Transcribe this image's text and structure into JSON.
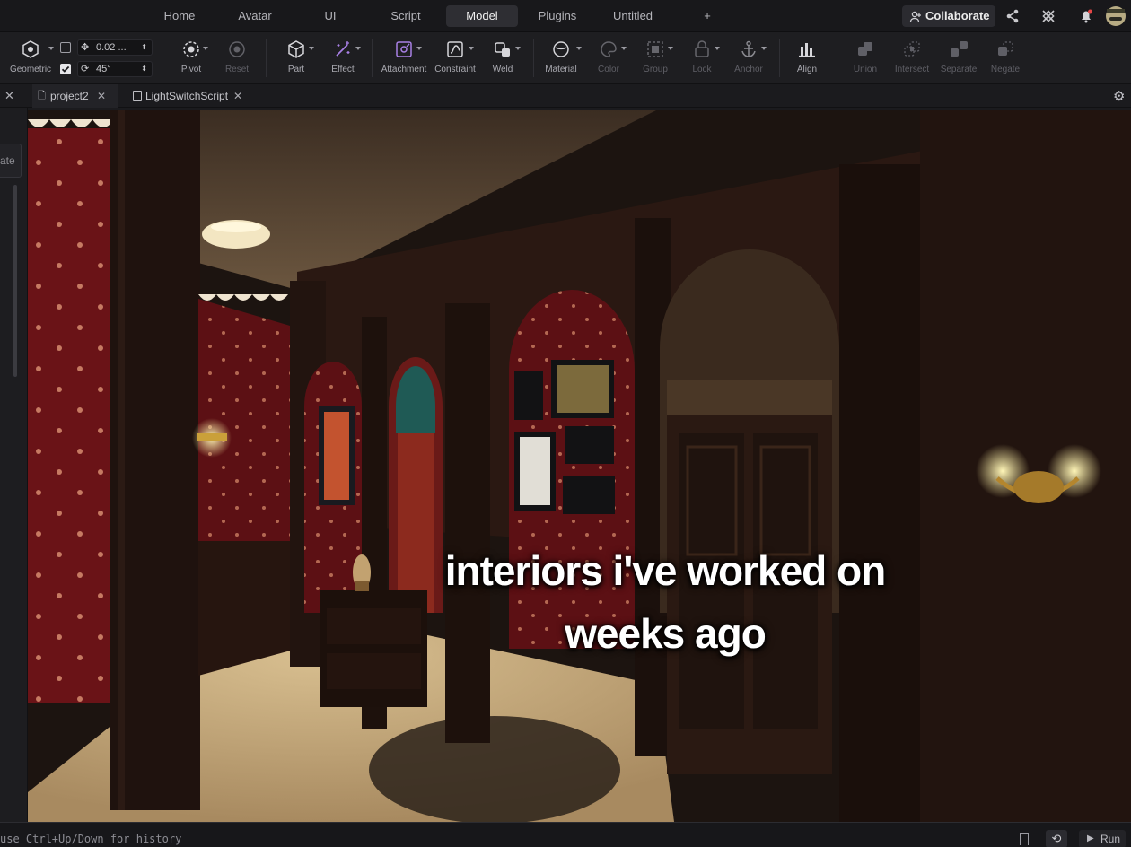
{
  "menubar": {
    "tabs": [
      "Home",
      "Avatar",
      "UI",
      "Script",
      "Model",
      "Plugins",
      "Untitled",
      "+"
    ],
    "active_tab": "Model",
    "collaborate_label": "Collaborate"
  },
  "ribbon": {
    "transform": {
      "mode_label": "Geometric",
      "move_snap_value": "0.02 ...",
      "rotate_snap_value": "45°",
      "move_snap_enabled": false,
      "rotate_snap_enabled": true
    },
    "tools": {
      "pivot": "Pivot",
      "reset": "Reset",
      "part": "Part",
      "effect": "Effect",
      "attachment": "Attachment",
      "constraint": "Constraint",
      "weld": "Weld",
      "material": "Material",
      "color": "Color",
      "group": "Group",
      "lock": "Lock",
      "anchor": "Anchor",
      "align": "Align",
      "union": "Union",
      "intersect": "Intersect",
      "separate": "Separate",
      "negate": "Negate"
    }
  },
  "documents": {
    "tabs": [
      {
        "label": "project2",
        "active": true
      },
      {
        "label": "LightSwitchScript",
        "active": false
      }
    ],
    "left_partial_label": "ate"
  },
  "viewport": {
    "caption_line1": "interiors i've worked on",
    "caption_line2": "weeks ago"
  },
  "statusbar": {
    "command_hint": "use Ctrl+Up/Down for history",
    "run_label": "Run"
  },
  "colors": {
    "accent_active_tab": "#2e2e33",
    "wallpaper_red": "#6e1418",
    "wood_dark": "#2a1712",
    "carpet": "#c9ad80",
    "lamp_glow": "#fff1a0"
  }
}
